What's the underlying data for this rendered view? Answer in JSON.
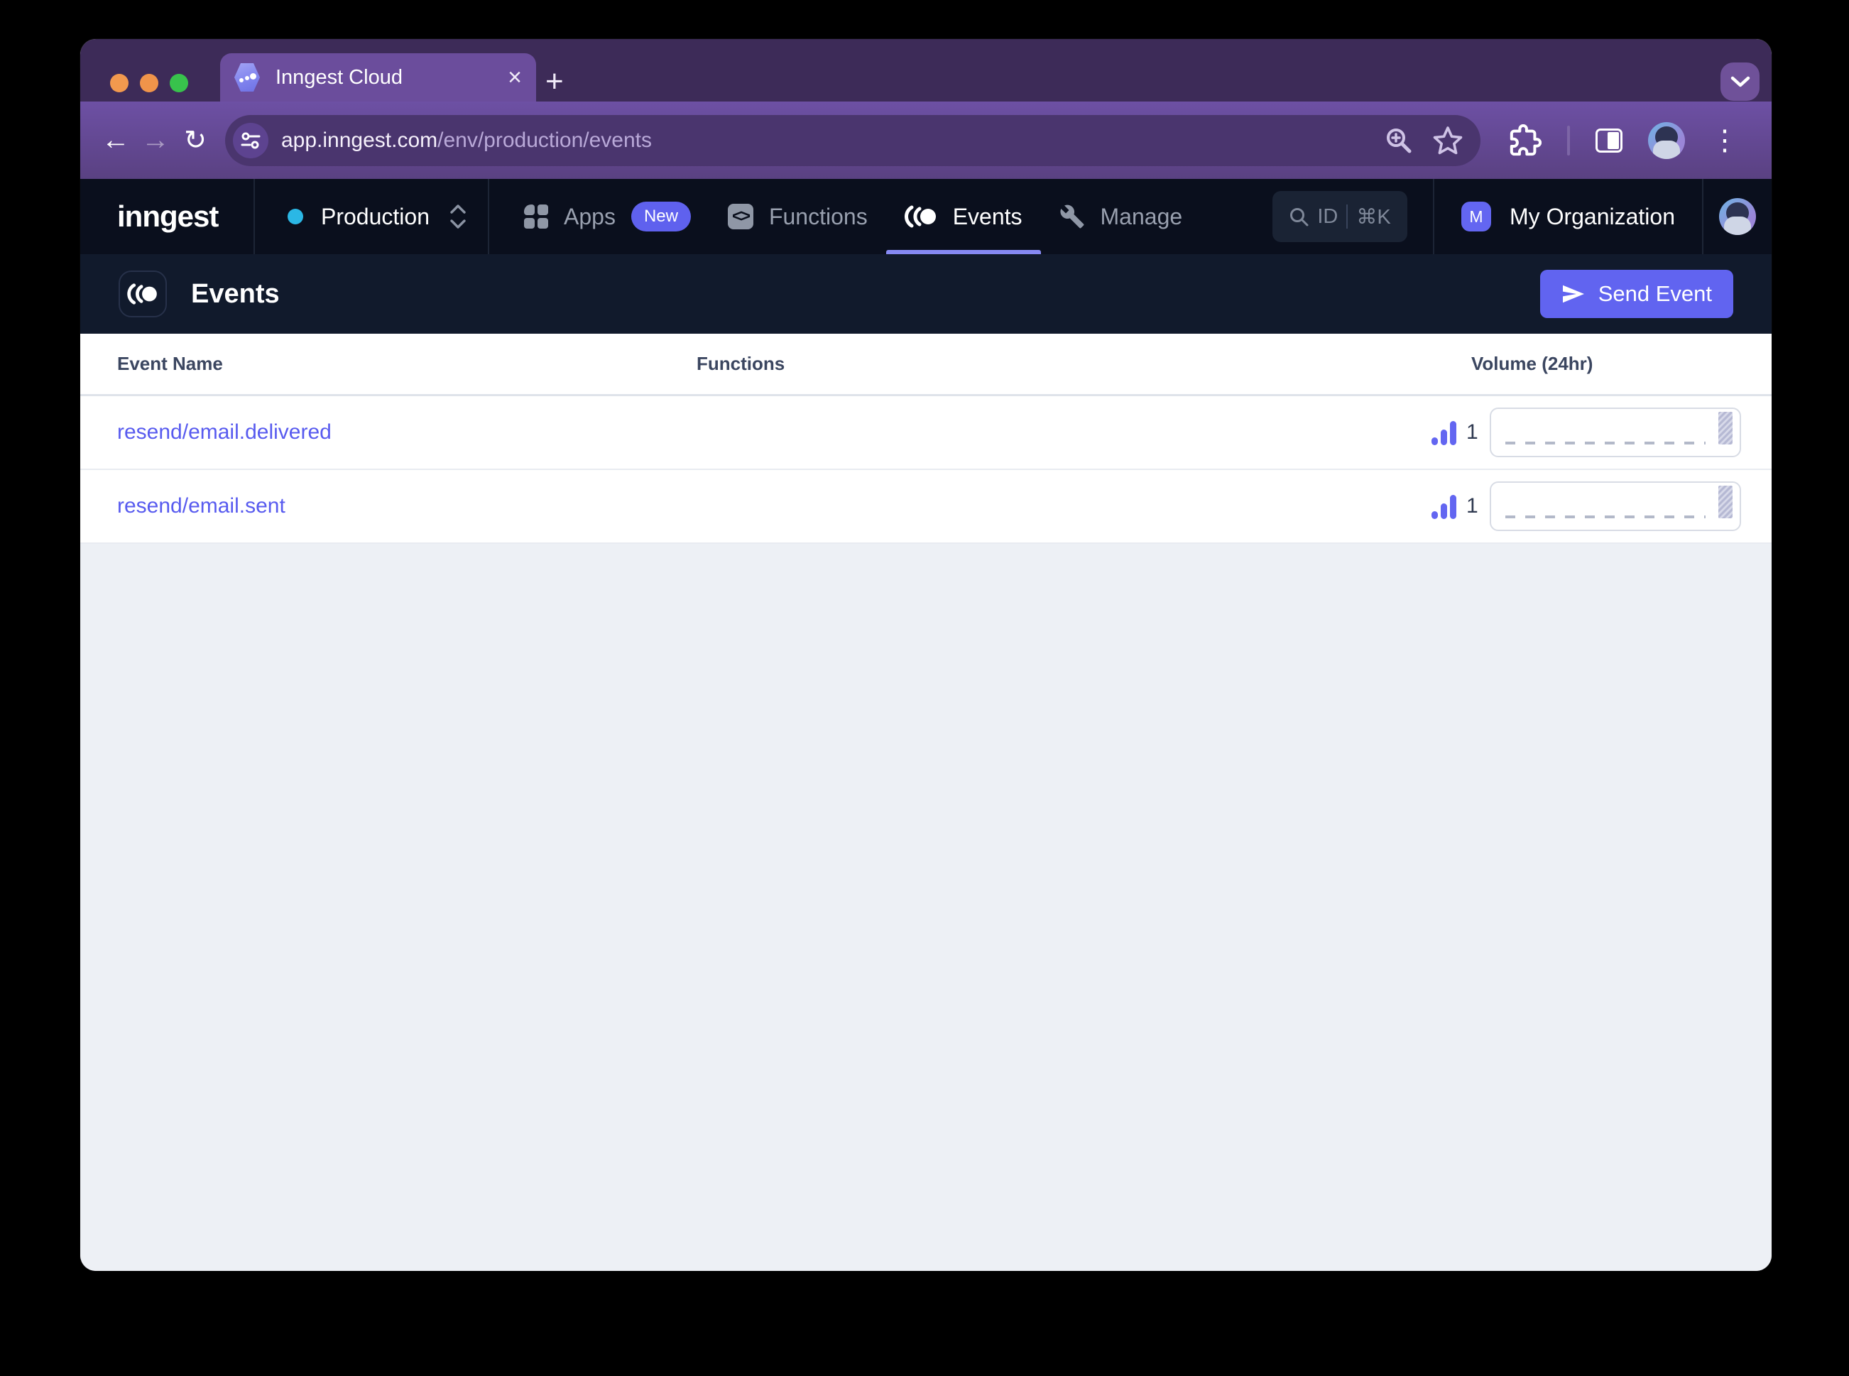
{
  "browser": {
    "tab_title": "Inngest Cloud",
    "close_tab": "×",
    "new_tab": "+",
    "url_host": "app.inngest.com",
    "url_path": "/env/production/events",
    "back": "←",
    "forward": "→",
    "reload": "↻",
    "menu_dots": "⋮"
  },
  "topnav": {
    "brand": "inngest",
    "env_label": "Production",
    "items": [
      {
        "label": "Apps",
        "badge": "New"
      },
      {
        "label": "Functions"
      },
      {
        "label": "Events"
      },
      {
        "label": "Manage"
      }
    ],
    "search_label": "ID",
    "search_shortcut": "⌘K",
    "org_initial": "M",
    "org_name": "My Organization"
  },
  "page": {
    "title": "Events",
    "send_button": "Send Event"
  },
  "table": {
    "headers": [
      "Event Name",
      "Functions",
      "Volume (24hr)"
    ],
    "rows": [
      {
        "name": "resend/email.delivered",
        "functions": "",
        "volume": "1",
        "spark": {
          "type": "bar",
          "latest_value": 1,
          "note": "single bar at most recent interval, flat dashed baseline"
        }
      },
      {
        "name": "resend/email.sent",
        "functions": "",
        "volume": "1",
        "spark": {
          "type": "bar",
          "latest_value": 1,
          "note": "single bar at most recent interval, flat dashed baseline"
        }
      }
    ]
  },
  "colors": {
    "accent_indigo": "#6366f1",
    "event_link": "#585bef",
    "production_dot": "#2bb7e5",
    "browser_frame": "#3d2b58",
    "browser_toolbar": "#5f4590",
    "app_nav_bg": "#0a0f1d",
    "page_header_bg": "#111a2c",
    "content_bg": "#edf0f5",
    "send_button_bg": "#6164f0"
  }
}
